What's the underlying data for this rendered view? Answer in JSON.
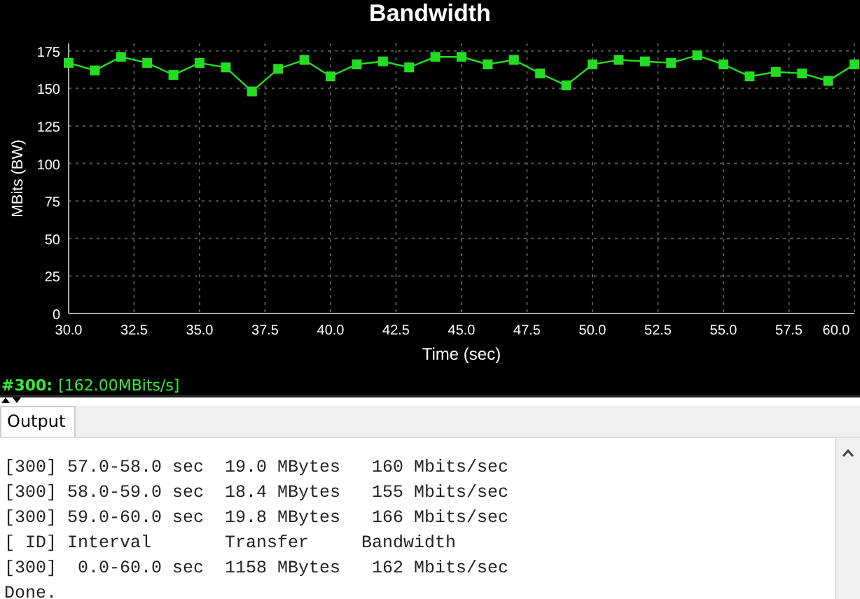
{
  "chart": {
    "chart_data": {
      "type": "line",
      "title": "Bandwidth",
      "xlabel": "Time (sec)",
      "ylabel": "MBits (BW)",
      "x": [
        30,
        31,
        32,
        33,
        34,
        35,
        36,
        37,
        38,
        39,
        40,
        41,
        42,
        43,
        44,
        45,
        46,
        47,
        48,
        49,
        50,
        51,
        52,
        53,
        54,
        55,
        56,
        57,
        58,
        59,
        60
      ],
      "grid": true,
      "series": [
        {
          "marker": "square",
          "color": "#22dd22",
          "values": [
            167,
            162,
            171,
            167,
            159,
            167,
            164,
            148,
            163,
            169,
            158,
            166,
            168,
            164,
            171,
            171,
            166,
            169,
            160,
            152,
            166,
            169,
            168,
            167,
            172,
            166,
            158,
            161,
            160,
            155,
            166
          ]
        }
      ],
      "xlim": [
        30,
        60
      ],
      "ylim": [
        0,
        180
      ],
      "xticks": [
        {
          "value": 30,
          "label": "30.0"
        },
        {
          "value": 32.5,
          "label": "32.5"
        },
        {
          "value": 35,
          "label": "35.0"
        },
        {
          "value": 37.5,
          "label": "37.5"
        },
        {
          "value": 40,
          "label": "40.0"
        },
        {
          "value": 42.5,
          "label": "42.5"
        },
        {
          "value": 45,
          "label": "45.0"
        },
        {
          "value": 47.5,
          "label": "47.5"
        },
        {
          "value": 50,
          "label": "50.0"
        },
        {
          "value": 52.5,
          "label": "52.5"
        },
        {
          "value": 55,
          "label": "55.0"
        },
        {
          "value": 57.5,
          "label": "57.5"
        },
        {
          "value": 60,
          "label": "60.0"
        }
      ],
      "yticks": [
        0,
        25,
        50,
        75,
        100,
        125,
        150,
        175
      ]
    }
  },
  "status": {
    "id": "#300:",
    "value": "[162.00MBits/s]"
  },
  "tabs": [
    {
      "label": "Output",
      "selected": true
    }
  ],
  "output": {
    "lines": [
      "[300] 57.0-58.0 sec  19.0 MBytes   160 Mbits/sec",
      "[300] 58.0-59.0 sec  18.4 MBytes   155 Mbits/sec",
      "[300] 59.0-60.0 sec  19.8 MBytes   166 Mbits/sec",
      "[ ID] Interval       Transfer     Bandwidth",
      "[300]  0.0-60.0 sec  1158 MBytes   162 Mbits/sec",
      "Done."
    ]
  }
}
